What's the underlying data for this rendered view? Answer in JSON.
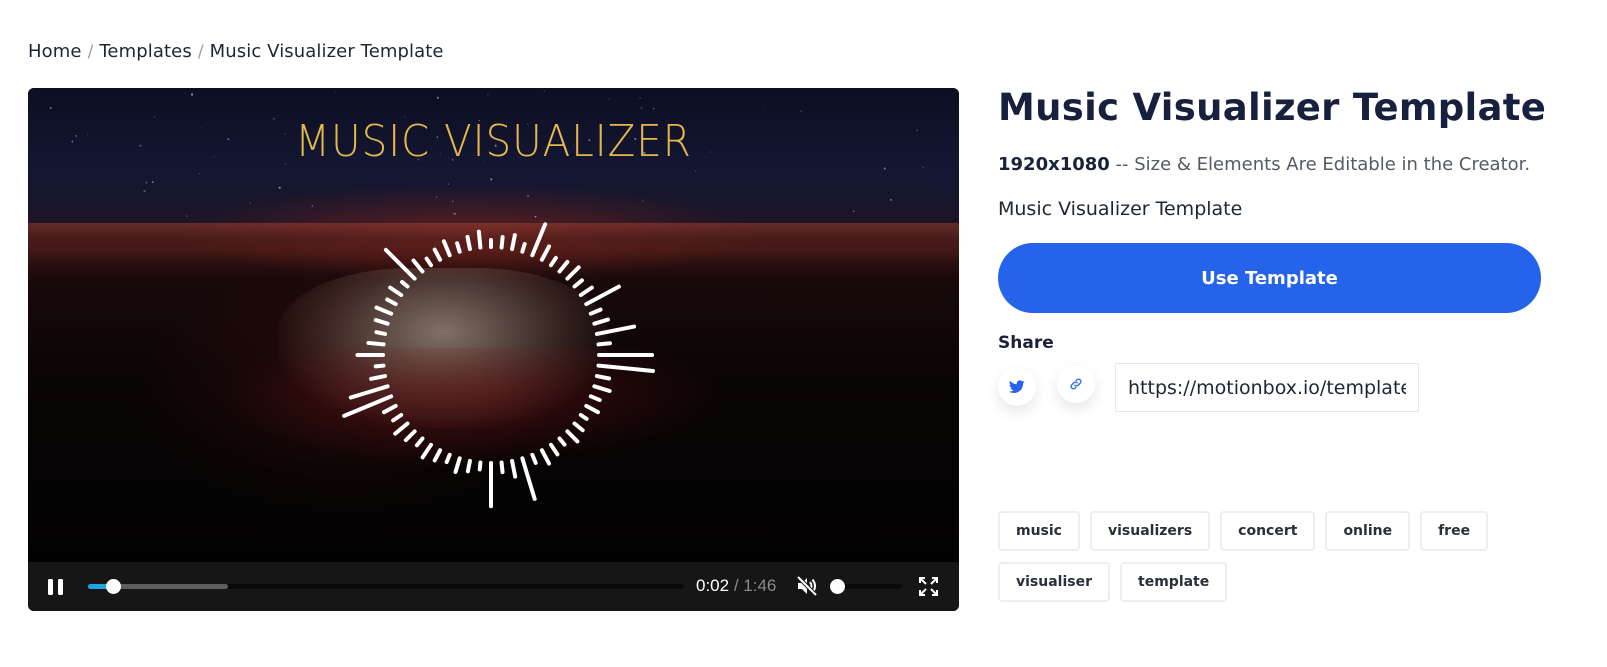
{
  "breadcrumb": {
    "items": [
      "Home",
      "Templates",
      "Music Visualizer Template"
    ],
    "separator": "/"
  },
  "player": {
    "video_title": "MUSIC VISUALIZER",
    "current_time": "0:02",
    "separator": " / ",
    "duration": "1:46",
    "progress_fraction": 0.03,
    "buffered_fraction": 0.235,
    "volume_fraction": 0.0,
    "muted": true,
    "state": "playing",
    "icons": {
      "pause": "pause-icon",
      "mute": "volume-muted-icon",
      "fullscreen": "fullscreen-icon"
    },
    "colors": {
      "progress": "#1fa4e0",
      "title": "#e6b84c"
    }
  },
  "details": {
    "title": "Music Visualizer Template",
    "resolution": "1920x1080",
    "description": " -- Size & Elements Are Editable in the Creator.",
    "subtitle": "Music Visualizer Template",
    "cta_label": "Use Template",
    "cta_color": "#2563eb",
    "share_label": "Share",
    "share_icons": [
      "twitter-icon",
      "link-icon"
    ],
    "share_url": "https://motionbox.io/templates/music-visualizer-template"
  },
  "tags": [
    "music",
    "visualizers",
    "concert",
    "online",
    "free",
    "visualiser",
    "template"
  ]
}
